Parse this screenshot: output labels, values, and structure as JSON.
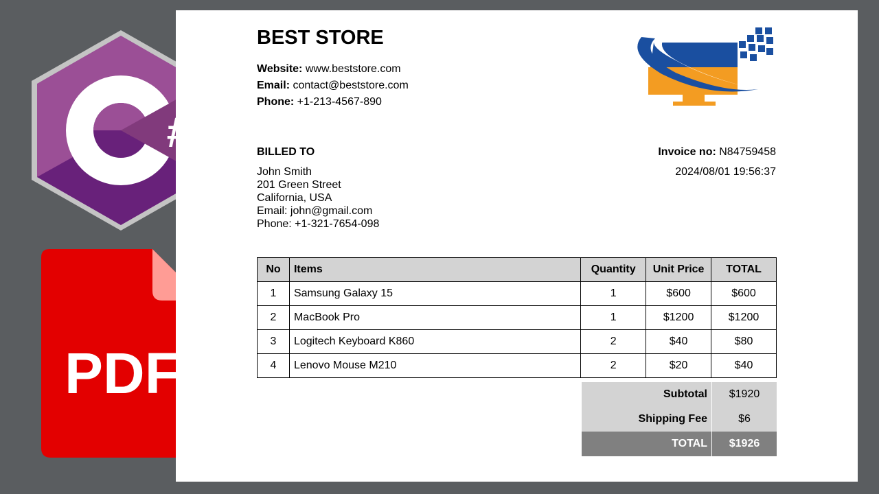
{
  "store": {
    "name": "BEST STORE",
    "website_label": "Website:",
    "website": "www.beststore.com",
    "email_label": "Email:",
    "email": "contact@beststore.com",
    "phone_label": "Phone:",
    "phone": "+1-213-4567-890"
  },
  "billed": {
    "heading": "BILLED TO",
    "lines": [
      "John Smith",
      "201 Green Street",
      "California, USA",
      "Email: john@gmail.com",
      "Phone: +1-321-7654-098"
    ]
  },
  "invoice": {
    "no_label": "Invoice no:",
    "no": "N84759458",
    "datetime": "2024/08/01 19:56:37"
  },
  "table": {
    "headers": [
      "No",
      "Items",
      "Quantity",
      "Unit Price",
      "TOTAL"
    ],
    "rows": [
      [
        "1",
        "Samsung Galaxy 15",
        "1",
        "$600",
        "$600"
      ],
      [
        "2",
        "MacBook Pro",
        "1",
        "$1200",
        "$1200"
      ],
      [
        "3",
        "Logitech Keyboard K860",
        "2",
        "$40",
        "$80"
      ],
      [
        "4",
        "Lenovo Mouse M210",
        "2",
        "$20",
        "$40"
      ]
    ]
  },
  "totals": {
    "subtotal_label": "Subtotal",
    "subtotal": "$1920",
    "shipping_label": "Shipping Fee",
    "shipping": "$6",
    "total_label": "TOTAL",
    "total": "$1926"
  },
  "icons": {
    "csharp": {
      "glyph": "#"
    },
    "pdf": {
      "label": "PDF"
    }
  },
  "colors": {
    "background": "#5a5d60",
    "csharp_purple": "#9b4f96",
    "pdf_red": "#e30000",
    "logo_blue": "#1a4fa0",
    "logo_orange": "#f39c22"
  }
}
